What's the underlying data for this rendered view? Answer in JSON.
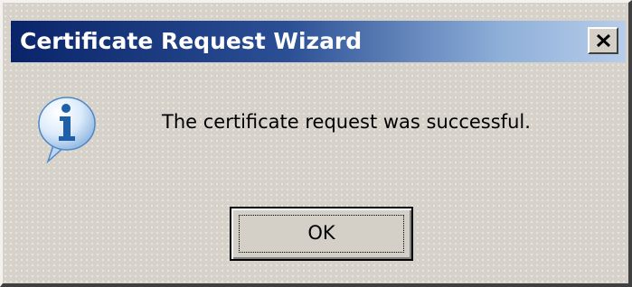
{
  "dialog": {
    "title": "Certificate Request Wizard",
    "message": "The certificate request was successful.",
    "ok_label": "OK",
    "icon": "info-icon",
    "close_icon": "close-icon"
  },
  "colors": {
    "title_bar_start": "#0a246a",
    "title_bar_end": "#b7cde9",
    "dialog_face": "#d4d0c8",
    "icon_blue": "#1f5fa8"
  }
}
